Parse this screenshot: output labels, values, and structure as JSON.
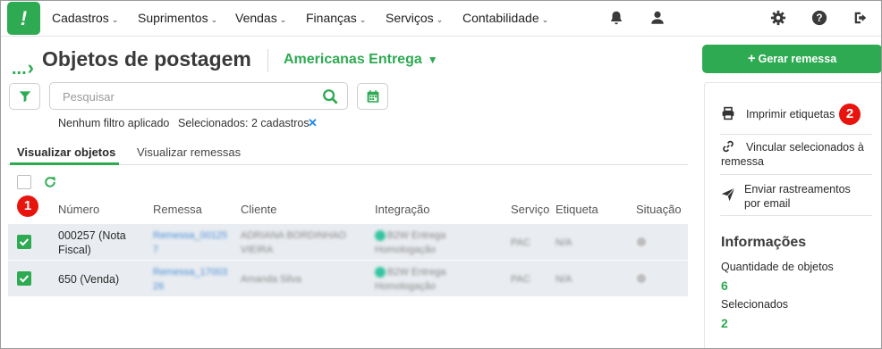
{
  "nav": {
    "logo": "!",
    "menus": [
      "Cadastros",
      "Suprimentos",
      "Vendas",
      "Finanças",
      "Serviços",
      "Contabilidade"
    ],
    "icons": [
      "bell-icon",
      "user-icon",
      "gear-icon",
      "help-icon",
      "logout-icon"
    ]
  },
  "breadcrumb": {
    "dots": "...",
    "title": "Objetos de postagem",
    "store": "Americanas Entrega"
  },
  "search": {
    "placeholder": "Pesquisar"
  },
  "filters": {
    "status": "Nenhum filtro aplicado",
    "selected": "Selecionados: 2 cadastros"
  },
  "tabs": [
    "Visualizar objetos",
    "Visualizar remessas"
  ],
  "table": {
    "headers": [
      "Número",
      "Remessa",
      "Cliente",
      "Integração",
      "Serviço",
      "Etiqueta",
      "Situação"
    ],
    "rows": [
      {
        "numero": "000257 (Nota Fiscal)",
        "remessa": "Remessa_00125 7",
        "cliente": "ADRIANA BORDINHAO VIEIRA",
        "integracao": "B2W Entrega Homologação",
        "servico": "PAC",
        "etiqueta": "N/A"
      },
      {
        "numero": "650 (Venda)",
        "remessa": "Remessa_17003 26",
        "cliente": "Amanda Silva",
        "integracao": "B2W Entrega Homologação",
        "servico": "PAC",
        "etiqueta": "N/A"
      }
    ]
  },
  "badges": [
    "1",
    "2"
  ],
  "panel": {
    "generate_button": "Gerar remessa",
    "actions": [
      "Imprimir etiquetas",
      "Vincular selecionados à remessa",
      "Enviar rastreamentos por email"
    ],
    "info_title": "Informações",
    "qty_label": "Quantidade de objetos",
    "qty_value": "6",
    "selected_label": "Selecionados",
    "selected_value": "2"
  },
  "colors": {
    "accent": "#2eaa52",
    "badge": "#e8140e",
    "link": "#1e88e5"
  }
}
